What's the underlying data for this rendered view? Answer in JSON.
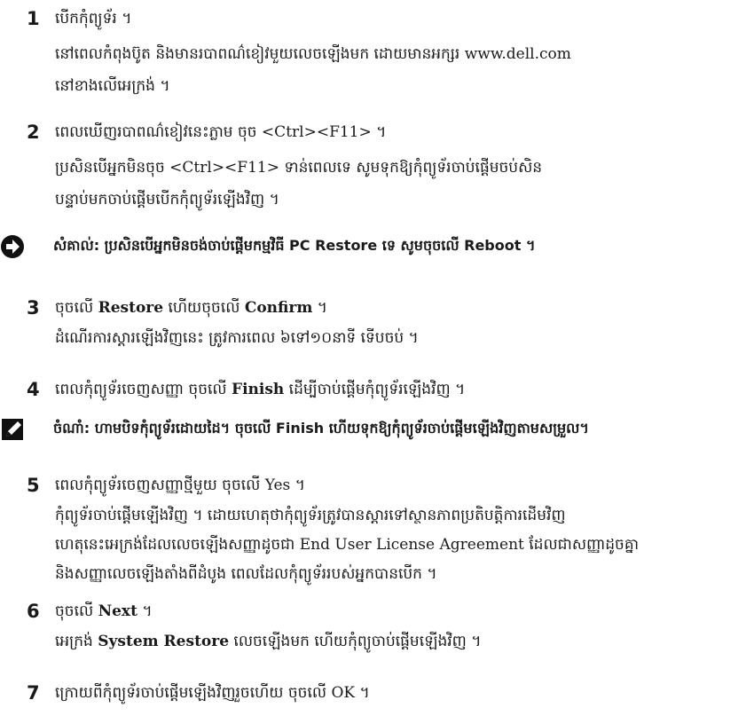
{
  "steps": [
    {
      "num": "1",
      "lines": [
        "បើកកុំព្យូទ័រ ។",
        "នៅពេលកំពុងប៊ូត និងមានរបាពណ៌ខៀវមួយលេចឡើងមក ដោយមានអក្សរ www.dell.com",
        "នៅខាងលើអេក្រង់ ។"
      ]
    },
    {
      "num": "2",
      "lines": [
        "ពេលឃើញរបាពណ៌ខៀវនេះភ្លាម ចុច <Ctrl><F11> ។",
        "ប្រសិនបើអ្នកមិនចុច <Ctrl><F11> ទាន់ពេលទេ សូមទុកឱ្យកុំព្យូទ័រចាប់ផ្តើមចប់សិន",
        "បន្ទាប់មកចាប់ផ្តើមបើកកុំព្យូទ័រឡើងវិញ ។"
      ]
    },
    {
      "num": "3",
      "pre": "ចុចលើ ",
      "bold1": "Restore",
      "mid": " ហើយចុចលើ ",
      "bold2": "Confirm",
      "post": " ។",
      "lines2": [
        "ដំណើរការស្តារឡើងវិញនេះ ត្រូវការពេល ៦ទៅ១០នាទី ទើបចប់ ។"
      ]
    },
    {
      "num": "4",
      "pre": "ពេលកុំព្យូទ័រចេញសញ្ញា ចុចលើ ",
      "bold1": "Finish",
      "post": " ដើម្បីចាប់ផ្តើមកុំព្យូទ័រឡើងវិញ ។"
    },
    {
      "num": "5",
      "lines": [
        "ពេលកុំព្យូទ័រចេញសញ្ញាថ្មីមួយ ចុចលើ Yes ។",
        "កុំព្យូទ័រចាប់ផ្តើមឡើងវិញ ។ ដោយហេតុថាកុំព្យូទ័រត្រូវបានស្តារទៅស្ថានភាពប្រតិបត្តិការដើមវិញ",
        "ហេតុនេះអេក្រង់ដែលលេចឡើងសញ្ញាដូចជា End User License Agreement ដែលជាសញ្ញាដូចគ្នា",
        "និងសញ្ញាលេចឡើងតាំងពីដំបូង ពេលដែលកុំព្យូទ័ររបស់អ្នកបានបើក ។"
      ]
    },
    {
      "num": "6",
      "pre": "ចុចលើ ",
      "bold1": "Next",
      "post": " ។",
      "pre2": "អេក្រង់ ",
      "bold2": "System Restore",
      "post2": " លេចឡើងមក ហើយកុំព្យូចាប់ផ្តើមឡើងវិញ ។"
    },
    {
      "num": "7",
      "lines": [
        "ក្រោយពីកុំព្យូទ័រចាប់ផ្តើមឡើងវិញរួចហើយ ចុចលើ OK ។"
      ]
    }
  ],
  "notes": {
    "caution": {
      "icon": "caution-arrow-icon",
      "text": "សំគាល់: ប្រសិនបើអ្នកមិនចង់ចាប់ផ្តើមកម្មវិធី PC Restore ទេ សូមចុចលើ Reboot ។"
    },
    "note": {
      "icon": "note-pencil-icon",
      "text": "ចំណាំ: ហាមបិទកុំព្យូទ័រដោយដៃ។ ចុចលើ Finish ហើយទុកឱ្យកុំព្យូទ័រចាប់ផ្តើមឡើងវិញតាមសម្រួល។"
    }
  }
}
